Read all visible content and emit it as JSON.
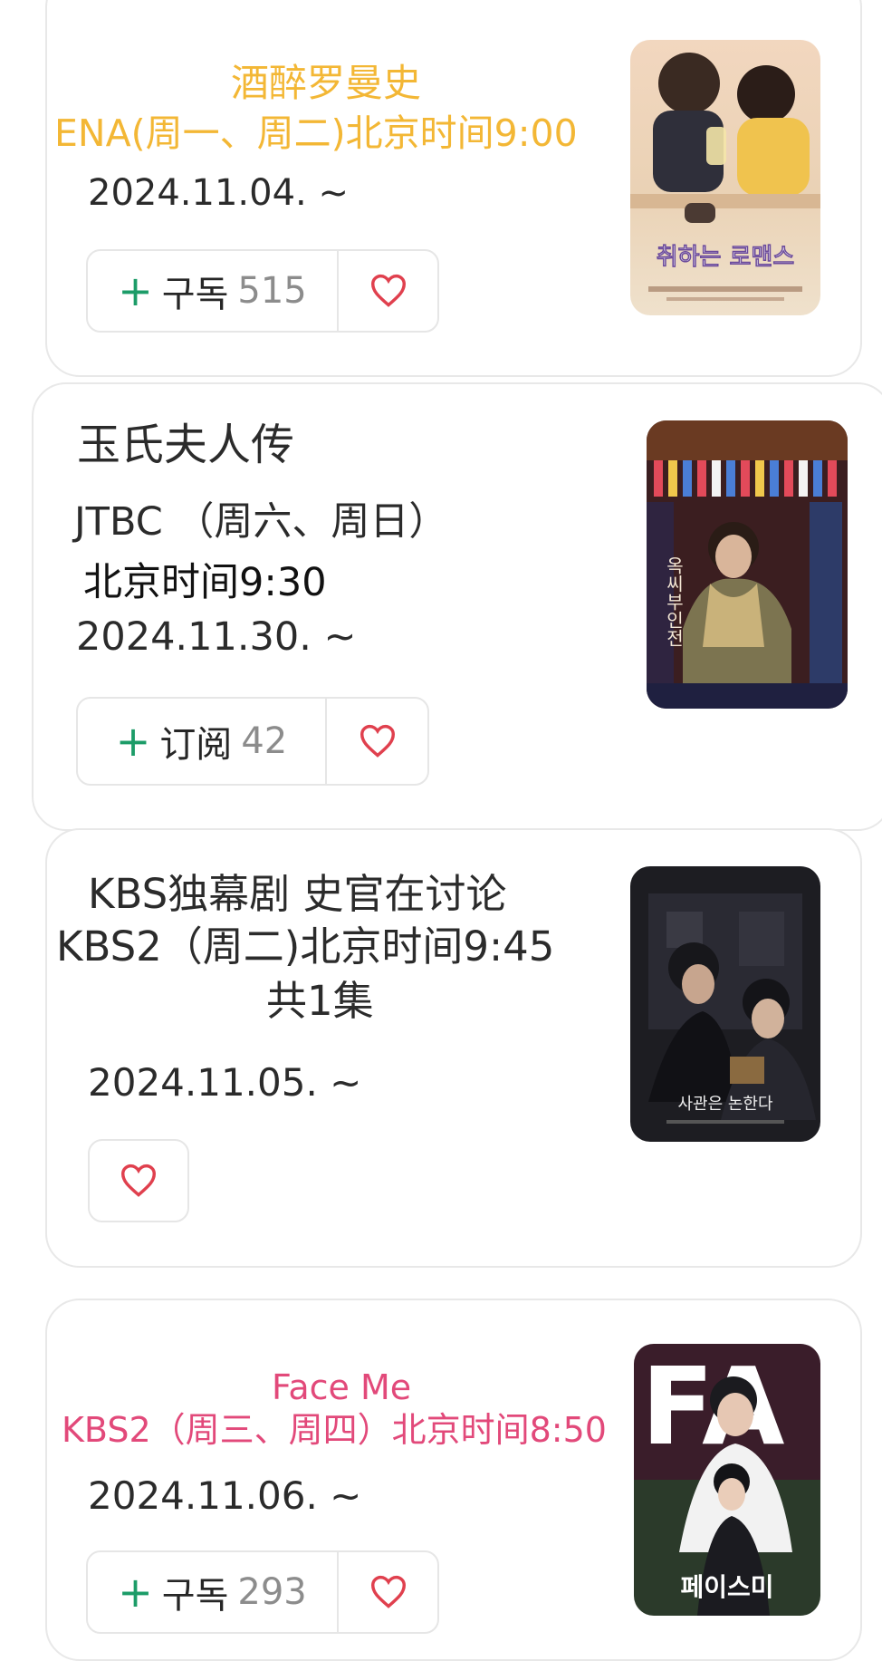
{
  "cards": [
    {
      "title": "酒醉罗曼史",
      "broadcast": "ENA(周一、周二)北京时间9:00",
      "date": "2024.11.04. ~",
      "subscribe_label": "구독",
      "subscribe_count": "515",
      "poster_text": "취하는 로맨스",
      "title_color": "#f3b735"
    },
    {
      "title": "玉氏夫人传",
      "broadcast": "JTBC （周六、周日）",
      "time": "北京时间9:30",
      "date": "2024.11.30. ~",
      "subscribe_label": "订阅",
      "subscribe_count": "42",
      "poster_text": "옥씨부인전"
    },
    {
      "title": "KBS独幕剧  史官在讨论",
      "broadcast": "KBS2（周二)北京时间9:45",
      "episodes": "共1集",
      "date": "2024.11.05. ~",
      "poster_text": "사관은 논한다"
    },
    {
      "title": "Face Me",
      "broadcast": "KBS2（周三、周四）北京时间8:50",
      "date": "2024.11.06. ~",
      "subscribe_label": "구독",
      "subscribe_count": "293",
      "poster_text": "페이스미",
      "poster_big": "FA",
      "title_color": "#e2497a"
    }
  ],
  "icons": {
    "plus": "plus-icon",
    "heart": "heart-icon"
  },
  "colors": {
    "accent_green": "#1c9c68",
    "heart_red": "#e0404e",
    "border": "#e8e8e8"
  }
}
